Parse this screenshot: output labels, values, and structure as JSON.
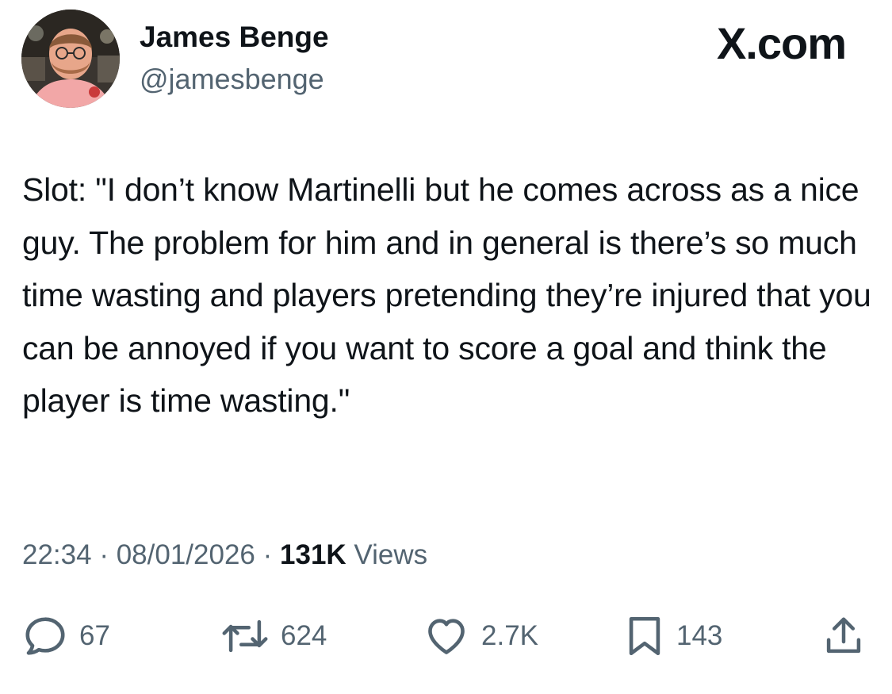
{
  "author": {
    "display_name": "James Benge",
    "handle": "@jamesbenge",
    "avatar_icon": "profile-photo"
  },
  "brand": {
    "label": "X.com"
  },
  "tweet": {
    "text": "Slot: \"I don’t know Martinelli but he comes across as a nice guy. The problem for him and in general is there’s so much time wasting and players pretending they’re injured that you can be annoyed if you want to score a goal and think the player is time wasting.\""
  },
  "meta": {
    "time": "22:34",
    "separator": "·",
    "date": "08/01/2026",
    "views_count": "131K",
    "views_label": "Views"
  },
  "actions": {
    "replies": {
      "icon": "reply-icon",
      "count": "67"
    },
    "reposts": {
      "icon": "repost-icon",
      "count": "624"
    },
    "likes": {
      "icon": "heart-icon",
      "count": "2.7K"
    },
    "bookmarks": {
      "icon": "bookmark-icon",
      "count": "143"
    },
    "share": {
      "icon": "share-icon"
    }
  },
  "colors": {
    "text_primary": "#0f1419",
    "text_secondary": "#536471",
    "background": "#ffffff"
  }
}
